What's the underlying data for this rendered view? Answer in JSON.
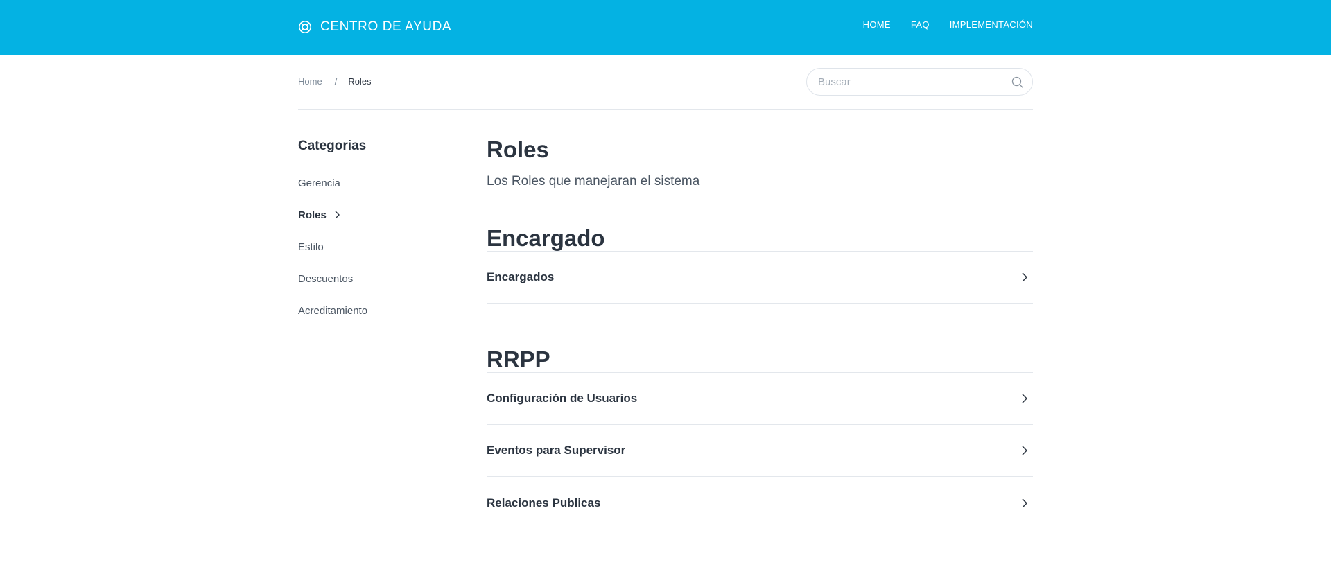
{
  "header": {
    "brand": "CENTRO DE AYUDA",
    "brand_icon": "lifebuoy-icon",
    "nav": [
      "HOME",
      "FAQ",
      "IMPLEMENTACIÓN"
    ],
    "background_color": "#04b2e3"
  },
  "breadcrumb": {
    "home": "Home",
    "separator": "/",
    "current": "Roles"
  },
  "search": {
    "placeholder": "Buscar",
    "icon": "search-icon"
  },
  "sidebar": {
    "title": "Categorias",
    "items": [
      {
        "label": "Gerencia"
      },
      {
        "label": "Roles"
      },
      {
        "label": "Estilo"
      },
      {
        "label": "Descuentos"
      },
      {
        "label": "Acreditamiento"
      }
    ],
    "active_item": "Roles"
  },
  "main": {
    "title": "Roles",
    "description": "Los Roles que manejaran el sistema",
    "sections": [
      {
        "title": "Encargado",
        "articles": [
          "Encargados"
        ]
      },
      {
        "title": "RRPP",
        "articles": [
          "Configuración de Usuarios",
          "Eventos para Supervisor",
          "Relaciones Publicas"
        ]
      }
    ]
  }
}
